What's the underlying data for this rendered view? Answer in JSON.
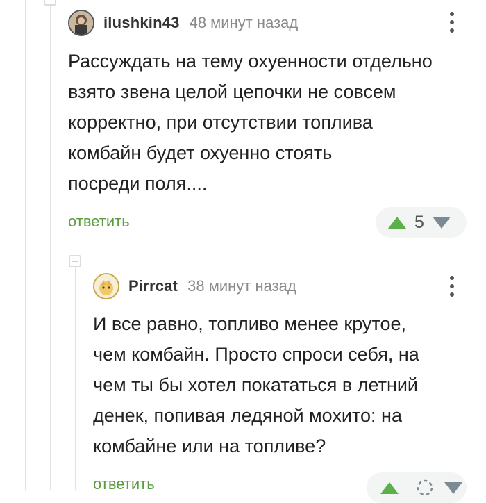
{
  "comments": [
    {
      "username": "ilushkin43",
      "time": "48 минут назад",
      "text": "Рассуждать на тему охуенности отдельно\nвзято звена целой цепочки не совсем\nкорректно, при отсутствии топлива\nкомбайн будет охуенно стоять\nпосреди поля....",
      "reply_label": "ответить",
      "rating": "5"
    },
    {
      "username": "Pirrcat",
      "time": "38 минут назад",
      "text": "И все равно, топливо менее крутое,\nчем комбайн. Просто спроси себя, на\nчем ты бы хотел покататься в летний\nденек, попивая ледяной мохито: на\nкомбайне или на топливе?",
      "reply_label": "ответить",
      "rating": ""
    }
  ],
  "colors": {
    "accent_green": "#5b9c3e",
    "upvote": "#5bb04a",
    "downvote": "#7d8a93"
  }
}
